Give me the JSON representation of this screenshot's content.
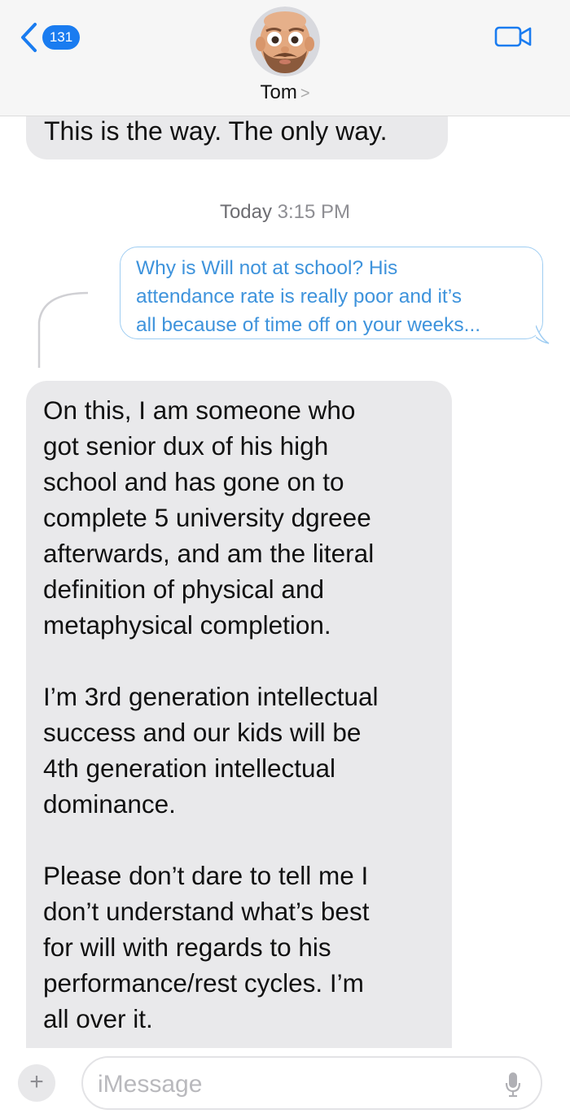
{
  "header": {
    "unread_count": "131",
    "contact_name": "Tom",
    "contact_chevron": ">"
  },
  "thread": {
    "previous_incoming": "This is the way. The only way.",
    "timestamp_day": "Today",
    "timestamp_time": "3:15 PM",
    "quoted_reply_lines": [
      "Why is Will not at school?  His",
      "attendance rate is really poor and it’s",
      "all because of time off on your weeks..."
    ],
    "incoming_lines": [
      "On this, I am someone who",
      "got senior dux of his high",
      "school and has gone on to",
      "complete 5 university dgreee",
      "afterwards, and am the literal",
      "definition of physical and",
      "metaphysical completion.",
      "",
      "I’m 3rd generation intellectual",
      "success and our kids will be",
      "4th generation intellectual",
      "dominance.",
      "",
      "Please don’t dare to tell me I",
      "don’t understand what’s best",
      "for will with regards to his",
      "performance/rest cycles. I’m",
      "all over it."
    ]
  },
  "composer": {
    "plus_label": "+",
    "placeholder": "iMessage"
  },
  "icons": {
    "back": "chevron-left-icon",
    "video": "video-camera-icon",
    "mic": "microphone-icon"
  },
  "colors": {
    "accent": "#1a7cf0",
    "incoming_bubble": "#e9e9eb",
    "quote_text": "#3e93dc"
  }
}
